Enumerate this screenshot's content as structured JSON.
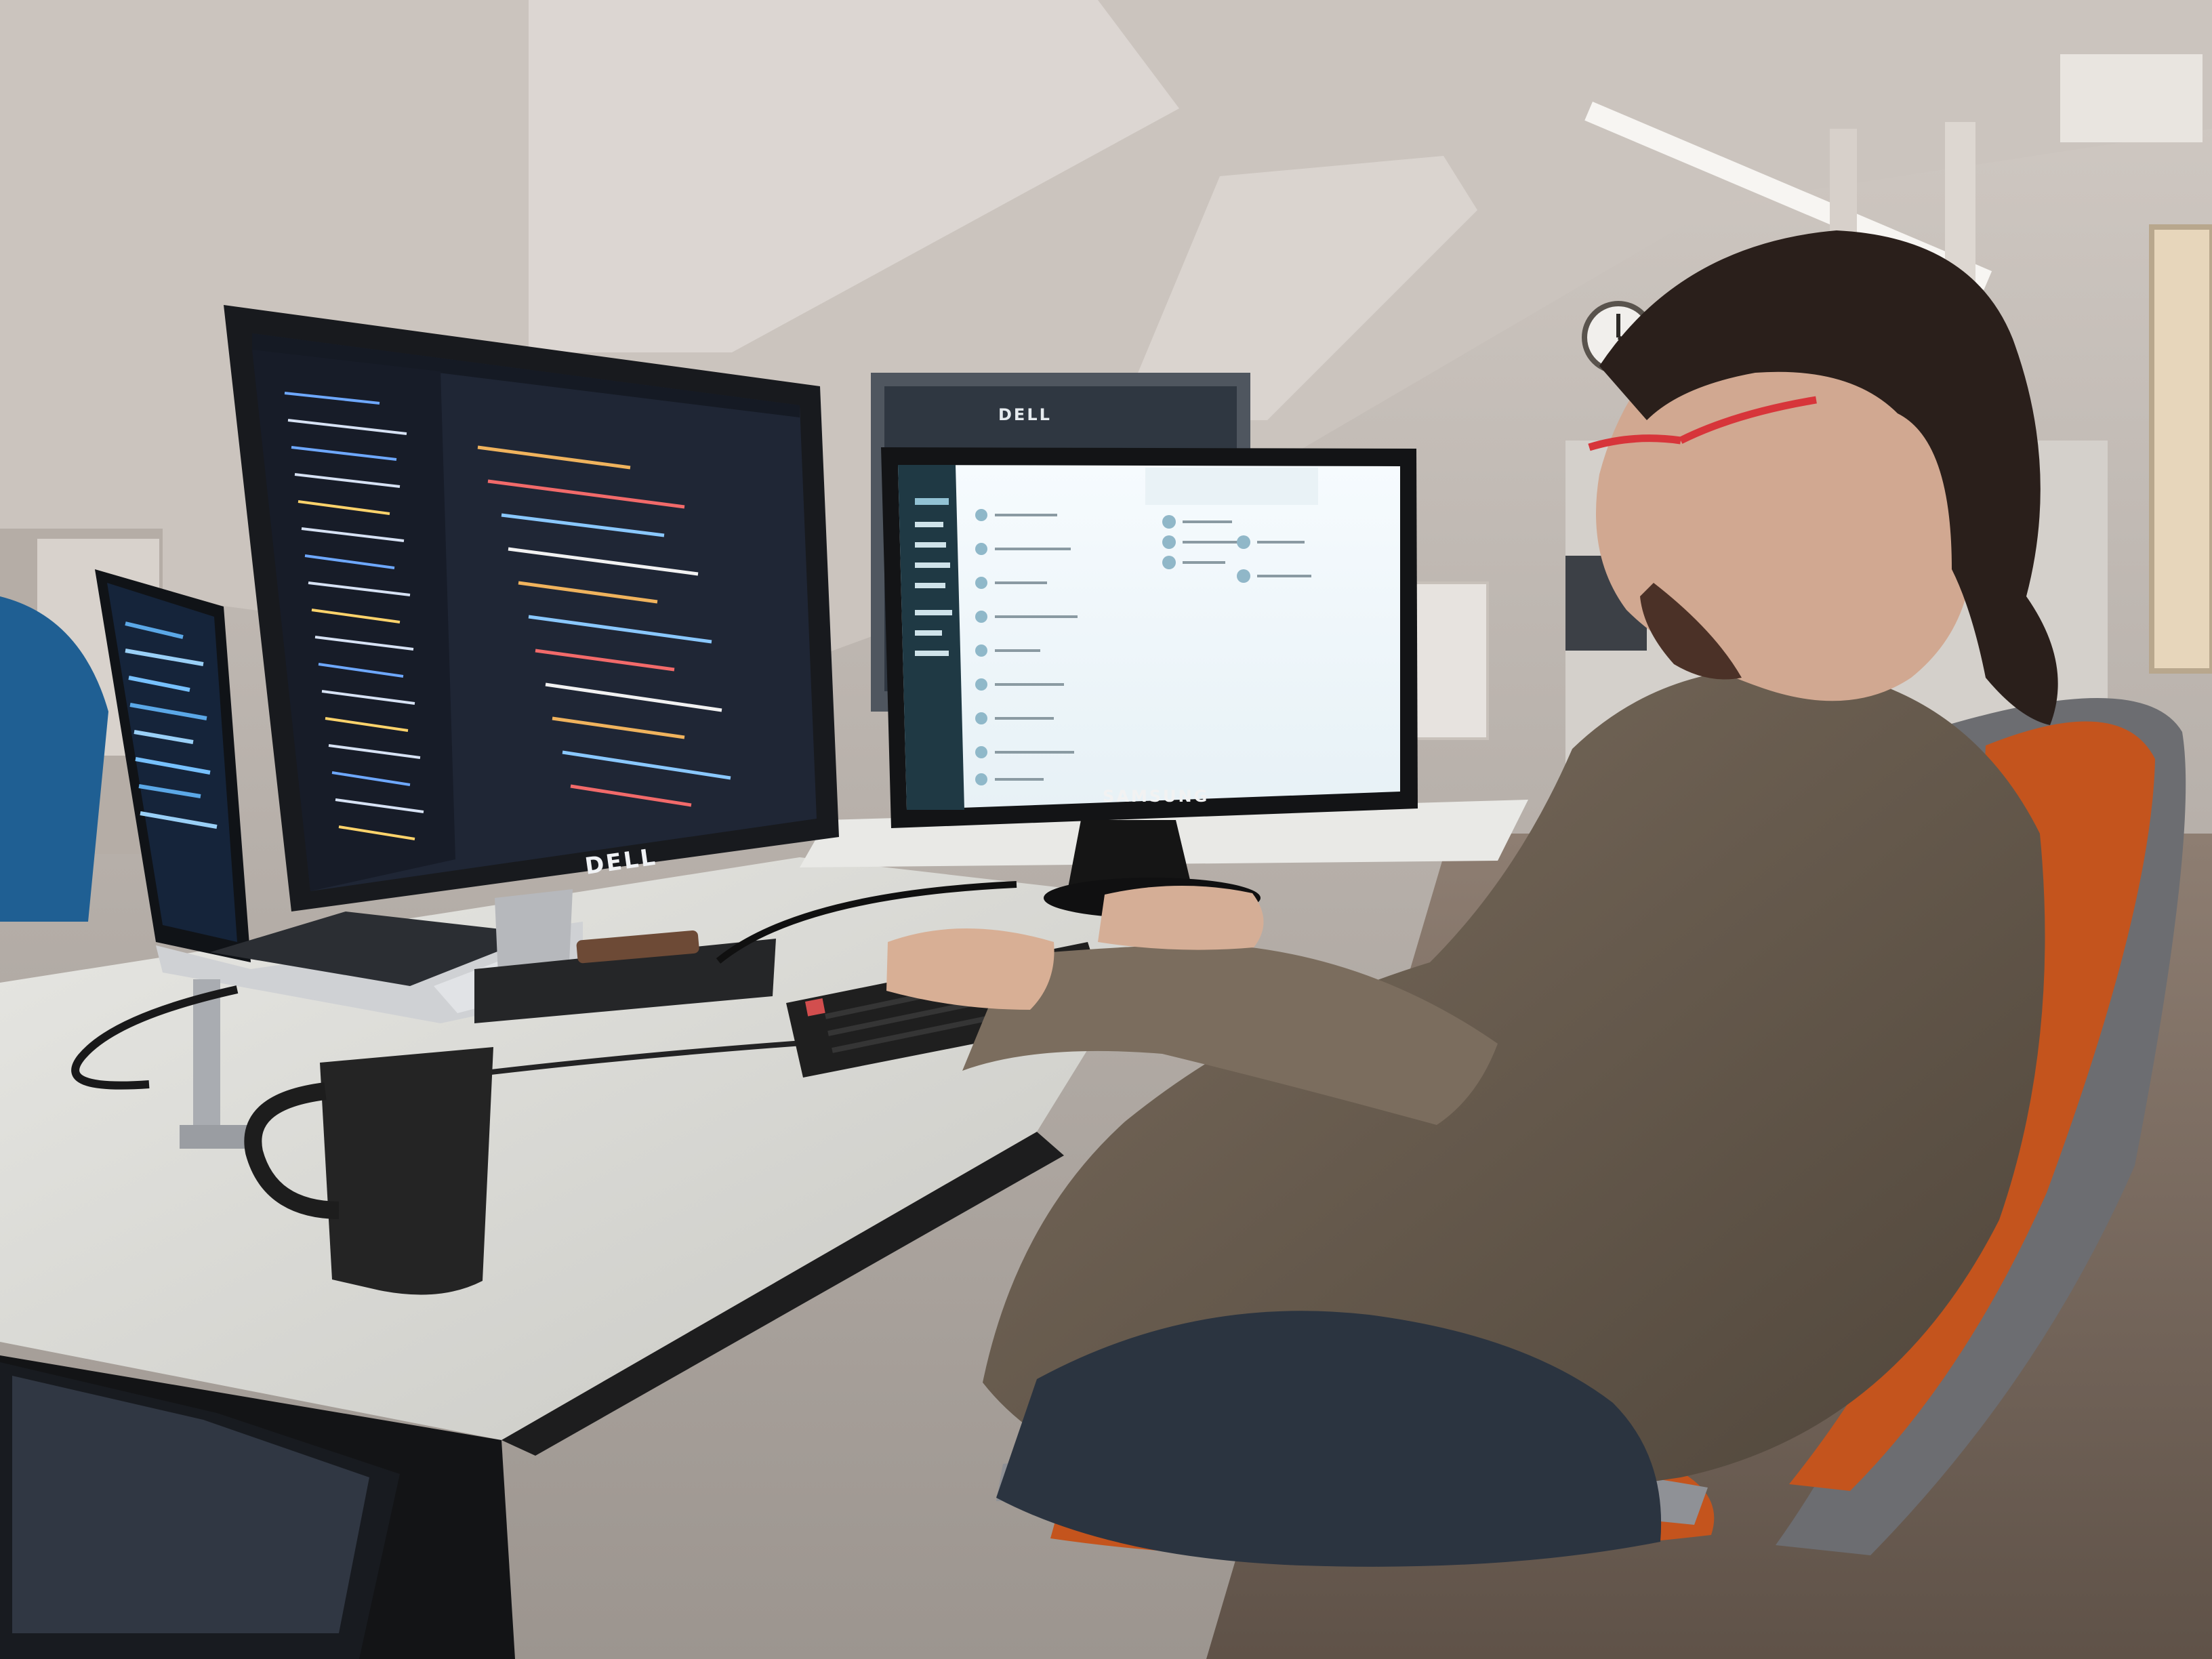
{
  "scene": {
    "brands": {
      "left_monitor": "DELL",
      "right_monitor": "SAMSUNG",
      "back_monitor": "DELL"
    },
    "colors": {
      "wall": "#b9b2ac",
      "ceiling": "#cfc8c2",
      "desk": "#e8e8e4",
      "ide_background": "#1f2635",
      "chat_background": "#f3f7fa",
      "chat_sidebar": "#1f3944",
      "sweater": "#6f6253",
      "chair_orange": "#c4541d",
      "mug": "#262626",
      "glasses": "#d7353a"
    }
  }
}
